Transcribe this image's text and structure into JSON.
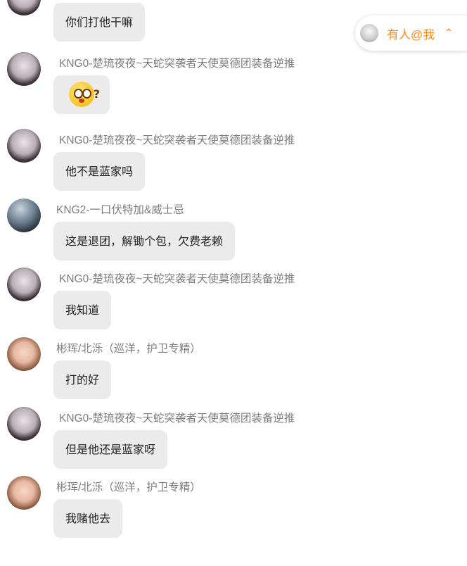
{
  "mention_banner": {
    "label": "有人@我",
    "chevron": "⌃"
  },
  "messages": [
    {
      "avatar": "girl",
      "sender": "",
      "text": "你们打他干嘛"
    },
    {
      "avatar": "girl",
      "sender": "KNG0-楚琉夜夜~天蛇突袭者天使莫德团装备逆推",
      "text": "",
      "emoji": "confused-face-emoji"
    },
    {
      "avatar": "girl",
      "sender": "KNG0-楚琉夜夜~天蛇突袭者天使莫德团装备逆推",
      "text": "他不是蓝家吗"
    },
    {
      "avatar": "dark",
      "sender": "KNG2-一口伏特加&威士忌",
      "text": "这是退团，解锄个包，欠费老赖"
    },
    {
      "avatar": "girl",
      "sender": "KNG0-楚琉夜夜~天蛇突袭者天使莫德团装备逆推",
      "text": "我知道"
    },
    {
      "avatar": "kid",
      "sender": "彬珲/北泺（巡洋，护卫专精）",
      "text": "打的好"
    },
    {
      "avatar": "girl",
      "sender": "KNG0-楚琉夜夜~天蛇突袭者天使莫德团装备逆推",
      "text": "但是他还是蓝家呀"
    },
    {
      "avatar": "kid",
      "sender": "彬珲/北泺（巡洋，护卫专精）",
      "text": "我赌他去"
    }
  ]
}
